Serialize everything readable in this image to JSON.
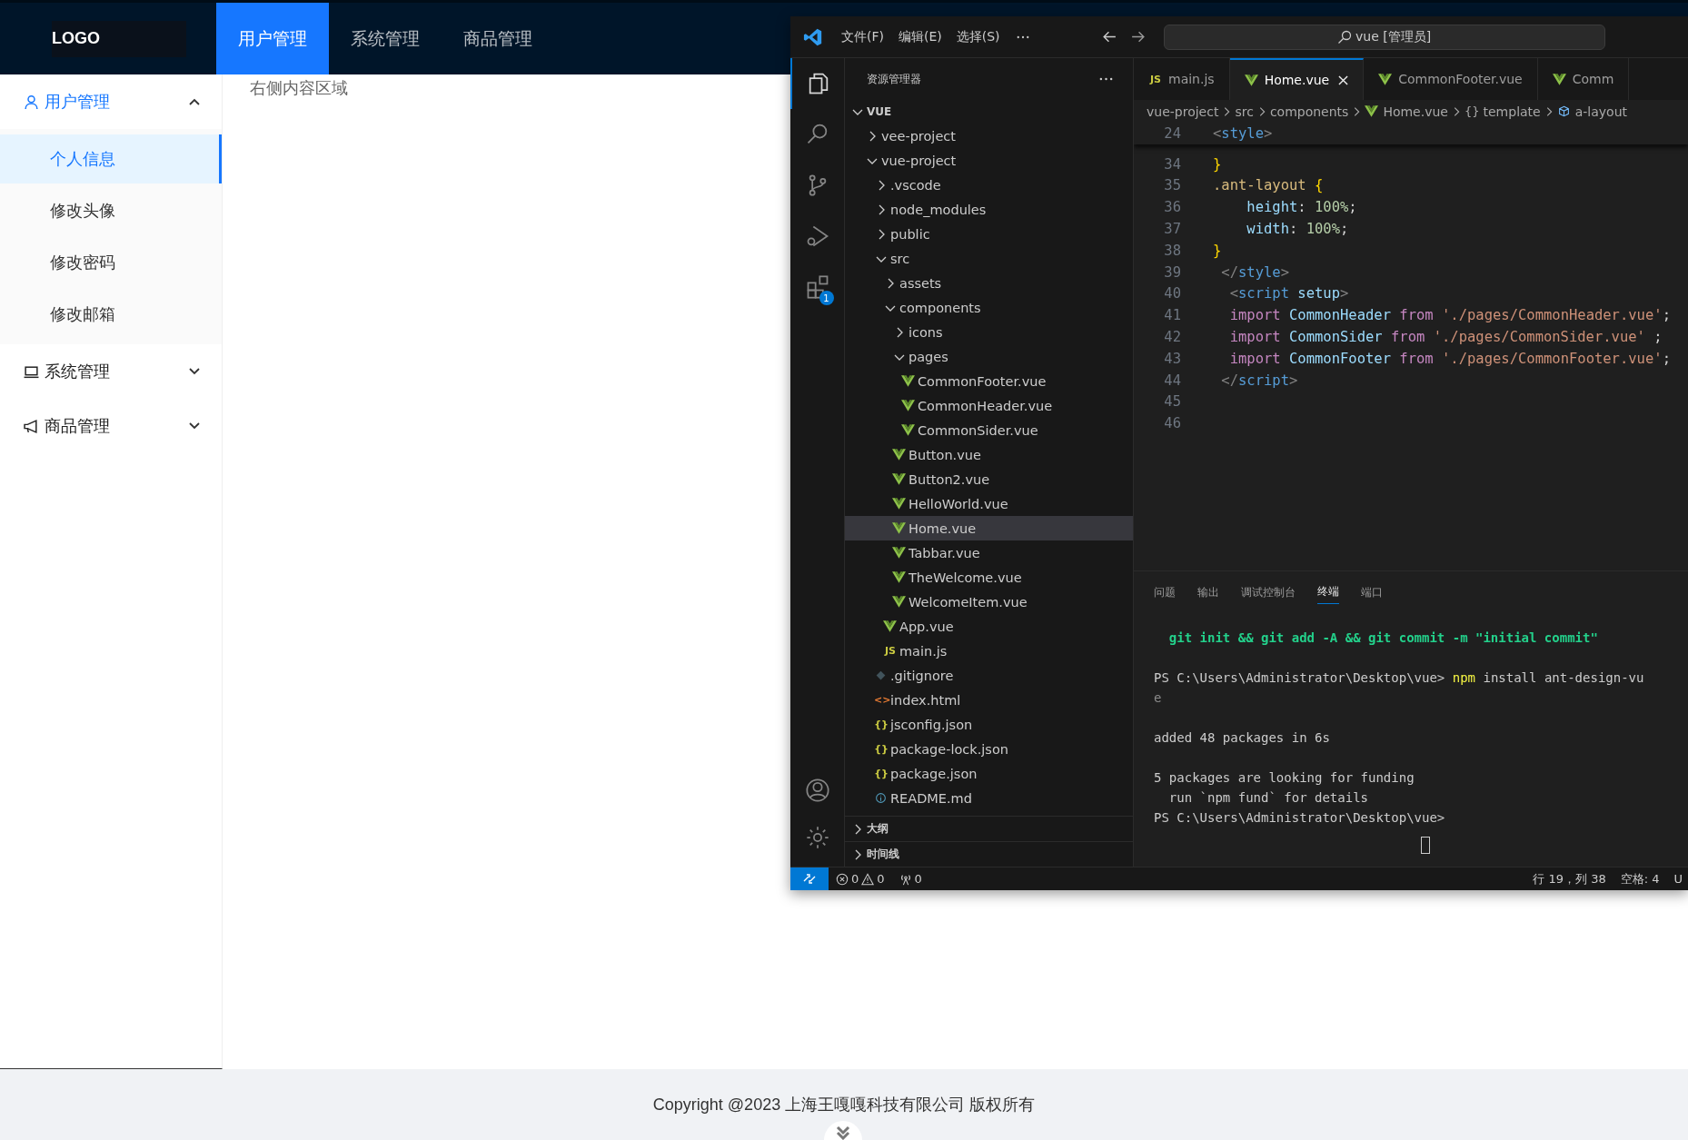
{
  "header": {
    "logo": "LOGO",
    "nav": [
      {
        "label": "用户管理",
        "selected": true
      },
      {
        "label": "系统管理",
        "selected": false
      },
      {
        "label": "商品管理",
        "selected": false
      }
    ]
  },
  "sidebar": {
    "menus": [
      {
        "label": "用户管理",
        "kind": "user",
        "expanded": true,
        "selected": true,
        "children": [
          {
            "label": "个人信息",
            "selected": true
          },
          {
            "label": "修改头像",
            "selected": false
          },
          {
            "label": "修改密码",
            "selected": false
          },
          {
            "label": "修改邮箱",
            "selected": false
          }
        ]
      },
      {
        "label": "系统管理",
        "kind": "laptop",
        "expanded": false,
        "selected": false
      },
      {
        "label": "商品管理",
        "kind": "megaphone",
        "expanded": false,
        "selected": false
      }
    ]
  },
  "content": {
    "text": "右侧内容区域"
  },
  "footer": {
    "text": "Copyright @2023 上海王嘎嘎科技有限公司 版权所有"
  },
  "vscode": {
    "menu": [
      "文件(F)",
      "编辑(E)",
      "选择(S)"
    ],
    "command_center": "vue [管理员]",
    "activity_bar": [
      {
        "kind": "explorer",
        "selected": true
      },
      {
        "kind": "search",
        "selected": false
      },
      {
        "kind": "scm",
        "selected": false
      },
      {
        "kind": "debug",
        "selected": false
      },
      {
        "kind": "extensions",
        "selected": false,
        "badge": "1"
      }
    ],
    "explorer": {
      "title": "资源管理器",
      "root": {
        "label": "VUE",
        "expanded": true
      },
      "tree": [
        {
          "label": "vee-project",
          "kind": "folder",
          "expanded": false,
          "selected": false
        },
        {
          "label": "vue-project",
          "kind": "folder",
          "expanded": true,
          "selected": false,
          "children": [
            {
              "label": ".vscode",
              "kind": "folder",
              "expanded": false,
              "selected": false
            },
            {
              "label": "node_modules",
              "kind": "folder",
              "expanded": false,
              "selected": false
            },
            {
              "label": "public",
              "kind": "folder",
              "expanded": false,
              "selected": false
            },
            {
              "label": "src",
              "kind": "folder",
              "expanded": true,
              "selected": false,
              "children": [
                {
                  "label": "assets",
                  "kind": "folder",
                  "expanded": false,
                  "selected": false
                },
                {
                  "label": "components",
                  "kind": "folder",
                  "expanded": true,
                  "selected": false,
                  "children": [
                    {
                      "label": "icons",
                      "kind": "folder",
                      "expanded": false,
                      "selected": false
                    },
                    {
                      "label": "pages",
                      "kind": "folder",
                      "expanded": true,
                      "selected": false,
                      "children": [
                        {
                          "label": "CommonFooter.vue",
                          "kind": "vue",
                          "selected": false
                        },
                        {
                          "label": "CommonHeader.vue",
                          "kind": "vue",
                          "selected": false
                        },
                        {
                          "label": "CommonSider.vue",
                          "kind": "vue",
                          "selected": false
                        }
                      ]
                    },
                    {
                      "label": "Button.vue",
                      "kind": "vue",
                      "selected": false
                    },
                    {
                      "label": "Button2.vue",
                      "kind": "vue",
                      "selected": false
                    },
                    {
                      "label": "HelloWorld.vue",
                      "kind": "vue",
                      "selected": false
                    },
                    {
                      "label": "Home.vue",
                      "kind": "vue",
                      "selected": true
                    },
                    {
                      "label": "Tabbar.vue",
                      "kind": "vue",
                      "selected": false
                    },
                    {
                      "label": "TheWelcome.vue",
                      "kind": "vue",
                      "selected": false
                    },
                    {
                      "label": "WelcomeItem.vue",
                      "kind": "vue",
                      "selected": false
                    }
                  ]
                },
                {
                  "label": "App.vue",
                  "kind": "vue",
                  "selected": false
                },
                {
                  "label": "main.js",
                  "kind": "js",
                  "icon_label": "JS",
                  "selected": false
                }
              ]
            },
            {
              "label": ".gitignore",
              "kind": "git",
              "selected": false
            },
            {
              "label": "index.html",
              "kind": "html",
              "icon_label": "<>",
              "selected": false
            },
            {
              "label": "jsconfig.json",
              "kind": "json",
              "icon_label": "{}",
              "selected": false
            },
            {
              "label": "package-lock.json",
              "kind": "json",
              "icon_label": "{}",
              "selected": false
            },
            {
              "label": "package.json",
              "kind": "json",
              "icon_label": "{}",
              "selected": false
            },
            {
              "label": "README.md",
              "kind": "info",
              "selected": false
            }
          ]
        }
      ],
      "sections": [
        {
          "label": "大纲",
          "expanded": false
        },
        {
          "label": "时间线",
          "expanded": false
        }
      ]
    },
    "tabs": [
      {
        "label": "main.js",
        "kind": "js",
        "icon_label": "JS",
        "selected": false
      },
      {
        "label": "Home.vue",
        "kind": "vue",
        "selected": true
      },
      {
        "label": "CommonFooter.vue",
        "kind": "vue",
        "selected": false
      },
      {
        "label": "Comm",
        "kind": "vue",
        "selected": false
      }
    ],
    "breadcrumb": [
      {
        "label": "vue-project",
        "kind": "text"
      },
      {
        "label": "src",
        "kind": "text"
      },
      {
        "label": "components",
        "kind": "text"
      },
      {
        "label": "Home.vue",
        "kind": "vue"
      },
      {
        "label": "template",
        "kind": "braces",
        "icon_label": "{}"
      },
      {
        "label": "a-layout",
        "kind": "element"
      }
    ],
    "sticky_line": {
      "number": "24",
      "tokens": [
        {
          "text": "<",
          "kind": "punct"
        },
        {
          "text": "style",
          "kind": "tag"
        },
        {
          "text": ">",
          "kind": "punct"
        }
      ]
    },
    "lines": [
      {
        "number": "34",
        "tokens": [
          {
            "text": "}",
            "kind": "brace"
          }
        ]
      },
      {
        "number": "35",
        "tokens": [
          {
            "text": ".ant-layout",
            "kind": "selector"
          },
          {
            "text": " {",
            "kind": "brace"
          }
        ]
      },
      {
        "number": "36",
        "tokens": [
          {
            "text": "    height",
            "kind": "prop"
          },
          {
            "text": ": ",
            "kind": "plain"
          },
          {
            "text": "100%",
            "kind": "num"
          },
          {
            "text": ";",
            "kind": "plain"
          }
        ]
      },
      {
        "number": "37",
        "tokens": [
          {
            "text": "    width",
            "kind": "prop"
          },
          {
            "text": ": ",
            "kind": "plain"
          },
          {
            "text": "100%",
            "kind": "num"
          },
          {
            "text": ";",
            "kind": "plain"
          }
        ]
      },
      {
        "number": "38",
        "tokens": [
          {
            "text": "}",
            "kind": "brace"
          }
        ]
      },
      {
        "number": "39",
        "tokens": [
          {
            "text": " </",
            "kind": "punct"
          },
          {
            "text": "style",
            "kind": "tag"
          },
          {
            "text": ">",
            "kind": "punct"
          }
        ]
      },
      {
        "number": "40",
        "tokens": [
          {
            "text": "  <",
            "kind": "punct"
          },
          {
            "text": "script",
            "kind": "tag"
          },
          {
            "text": " setup",
            "kind": "attr"
          },
          {
            "text": ">",
            "kind": "punct"
          }
        ]
      },
      {
        "number": "41",
        "tokens": [
          {
            "text": "  import",
            "kind": "keyword"
          },
          {
            "text": " CommonHeader",
            "kind": "ident"
          },
          {
            "text": " from",
            "kind": "keyword"
          },
          {
            "text": " './pages/CommonHeader.vue'",
            "kind": "string"
          },
          {
            "text": ";",
            "kind": "plain"
          }
        ]
      },
      {
        "number": "42",
        "tokens": [
          {
            "text": "  import",
            "kind": "keyword"
          },
          {
            "text": " CommonSider",
            "kind": "ident"
          },
          {
            "text": " from",
            "kind": "keyword"
          },
          {
            "text": " './pages/CommonSider.vue'",
            "kind": "string"
          },
          {
            "text": " ;",
            "kind": "plain"
          }
        ]
      },
      {
        "number": "43",
        "tokens": [
          {
            "text": "  import",
            "kind": "keyword"
          },
          {
            "text": " CommonFooter",
            "kind": "ident"
          },
          {
            "text": " from",
            "kind": "keyword"
          },
          {
            "text": " './pages/CommonFooter.vue'",
            "kind": "string"
          },
          {
            "text": ";",
            "kind": "plain"
          }
        ]
      },
      {
        "number": "44",
        "tokens": [
          {
            "text": " </",
            "kind": "punct"
          },
          {
            "text": "script",
            "kind": "tag"
          },
          {
            "text": ">",
            "kind": "punct"
          }
        ]
      },
      {
        "number": "45"
      },
      {
        "number": "46"
      }
    ],
    "panel_tabs": [
      {
        "label": "问题",
        "selected": false
      },
      {
        "label": "输出",
        "selected": false
      },
      {
        "label": "调试控制台",
        "selected": false
      },
      {
        "label": "终端",
        "selected": true
      },
      {
        "label": "端口",
        "selected": false
      }
    ],
    "terminal": [
      [
        [
          {
            "text": "  git init && git add -A && git commit -m \"initial commit\"",
            "kind": "git"
          }
        ]
      ],
      [
        [
          {
            "text": "PS C:\\Users\\Administrator\\Desktop\\vue> ",
            "kind": "plain"
          },
          {
            "text": "npm",
            "kind": "command"
          },
          {
            "text": " install ant-design-vu",
            "kind": "plain"
          }
        ],
        [
          {
            "text": "e",
            "kind": "dim"
          }
        ]
      ],
      [
        [
          {
            "text": "added 48 packages in 6s",
            "kind": "plain"
          }
        ]
      ],
      [
        [
          {
            "text": "5 packages are looking for funding",
            "kind": "plain"
          }
        ],
        [
          {
            "text": "  run `npm fund` for details",
            "kind": "plain"
          }
        ],
        [
          {
            "text": "PS C:\\Users\\Administrator\\Desktop\\vue>",
            "kind": "plain"
          }
        ]
      ]
    ],
    "status_bar": {
      "errors": "0",
      "warnings": "0",
      "ports": "0",
      "position": "行 19，列 38",
      "spaces": "空格: 4",
      "encoding": "U"
    }
  }
}
